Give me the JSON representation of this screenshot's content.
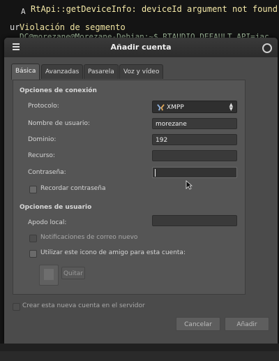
{
  "terminal": {
    "line1": "RtApi::getDeviceInfo: deviceId argument not found.",
    "prefix1": "A",
    "line2": "Violación de segmento",
    "prefix2": "ur",
    "line3": "DC@morezane@Morezane-Debian:~$ RTAUDIO_DEFAULT_API=jac"
  },
  "window": {
    "title": "Añadir cuenta"
  },
  "tabs": [
    {
      "label": "Básica",
      "active": true
    },
    {
      "label": "Avanzadas",
      "active": false
    },
    {
      "label": "Pasarela",
      "active": false
    },
    {
      "label": "Voz y vídeo",
      "active": false
    }
  ],
  "connection": {
    "section_title": "Opciones de conexión",
    "protocol_label": "Protocolo:",
    "protocol_value": "XMPP",
    "username_label": "Nombre de usuario:",
    "username_value": "morezane",
    "domain_label": "Dominio:",
    "domain_value": "192",
    "resource_label": "Recurso:",
    "resource_value": "",
    "password_label": "Contraseña:",
    "password_value": "",
    "remember_password_label": "Recordar contraseña"
  },
  "user_options": {
    "section_title": "Opciones de usuario",
    "local_alias_label": "Apodo local:",
    "local_alias_value": "",
    "new_mail_label": "Notificaciones de correo nuevo",
    "buddy_icon_label": "Utilizar este icono de amigo para esta cuenta:",
    "remove_label": "Quitar"
  },
  "create_on_server_label": "Crear esta nueva cuenta en el servidor",
  "buttons": {
    "cancel": "Cancelar",
    "add": "Añadir"
  },
  "colors": {
    "terminal_text": "#f3e8b0",
    "window_bg": "#4b4b4b",
    "titlebar_bg": "#2c2c2c"
  }
}
